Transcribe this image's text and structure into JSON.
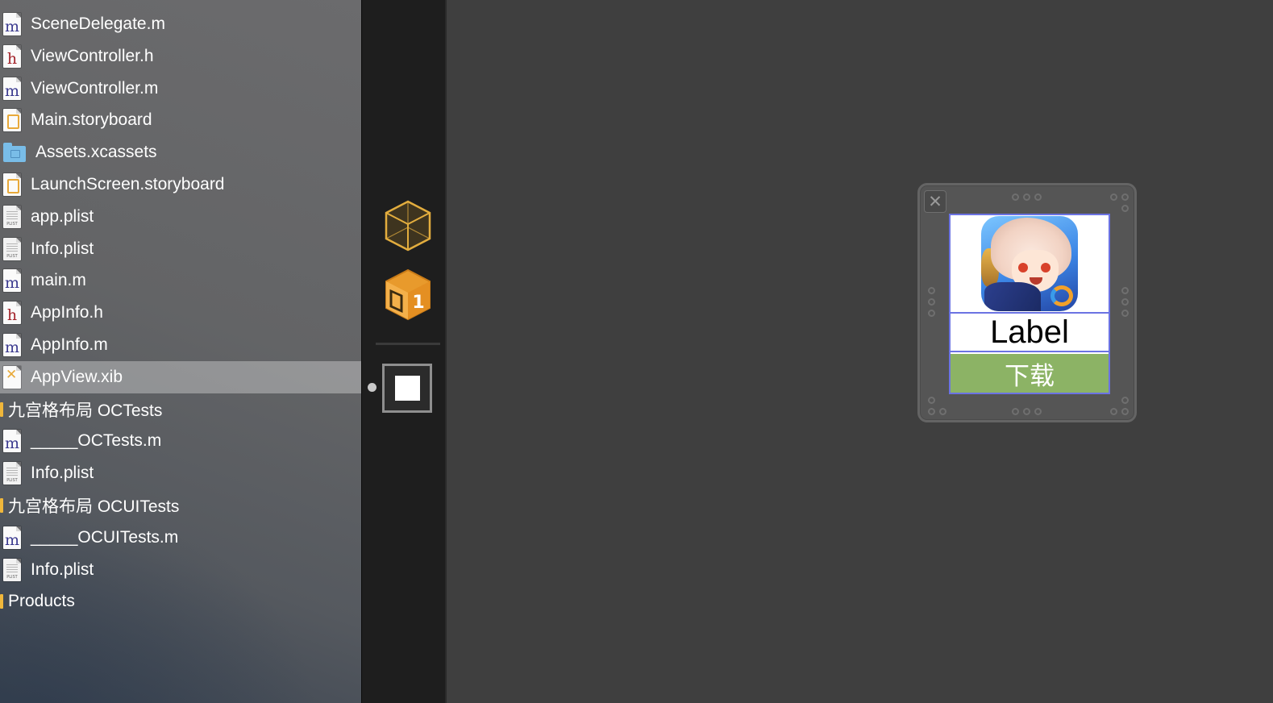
{
  "navigator": {
    "rows": [
      {
        "kind": "file",
        "type": "m",
        "name": "SceneDelegate.m",
        "selected": false
      },
      {
        "kind": "file",
        "type": "h",
        "name": "ViewController.h",
        "selected": false
      },
      {
        "kind": "file",
        "type": "m",
        "name": "ViewController.m",
        "selected": false
      },
      {
        "kind": "file",
        "type": "storyboard",
        "name": "Main.storyboard",
        "selected": false
      },
      {
        "kind": "folder",
        "type": "xcassets",
        "name": "Assets.xcassets",
        "selected": false
      },
      {
        "kind": "file",
        "type": "storyboard",
        "name": "LaunchScreen.storyboard",
        "selected": false
      },
      {
        "kind": "file",
        "type": "plist",
        "name": "app.plist",
        "selected": false
      },
      {
        "kind": "file",
        "type": "plist",
        "name": "Info.plist",
        "selected": false
      },
      {
        "kind": "file",
        "type": "m",
        "name": "main.m",
        "selected": false
      },
      {
        "kind": "file",
        "type": "h",
        "name": "AppInfo.h",
        "selected": false
      },
      {
        "kind": "file",
        "type": "m",
        "name": "AppInfo.m",
        "selected": false
      },
      {
        "kind": "file",
        "type": "xib",
        "name": "AppView.xib",
        "selected": true
      },
      {
        "kind": "group",
        "type": "group",
        "name": "九宫格布局 OCTests",
        "selected": false
      },
      {
        "kind": "file",
        "type": "m",
        "name": "_____OCTests.m",
        "selected": false
      },
      {
        "kind": "file",
        "type": "plist",
        "name": "Info.plist",
        "selected": false
      },
      {
        "kind": "group",
        "type": "group",
        "name": "九宫格布局 OCUITests",
        "selected": false
      },
      {
        "kind": "file",
        "type": "m",
        "name": "_____OCUITests.m",
        "selected": false
      },
      {
        "kind": "file",
        "type": "plist",
        "name": "Info.plist",
        "selected": false
      },
      {
        "kind": "group",
        "type": "group",
        "name": "Products",
        "selected": false
      }
    ],
    "icon_glyphs": {
      "m": "m",
      "h": "h",
      "plist": "PLIST"
    }
  },
  "dock": {
    "placeholder_icon": "placeholder-cube-icon",
    "file_owner_icon": "file-owner-cube-icon",
    "file_owner_badge": "1",
    "view_icon": "view-object-icon"
  },
  "canvas": {
    "close_glyph": "✕",
    "app_view": {
      "label_text": "Label",
      "button_title": "下载",
      "button_color": "#8cb365",
      "selection_color": "#6b73e3"
    }
  },
  "colors": {
    "navigator_bg": "#666668",
    "selection": "#9a9a9a",
    "canvas_bg": "#3f3f3f",
    "group_marker": "#f0b73b",
    "swift_m_glyph": "#3b3a8f",
    "h_glyph": "#a3232a"
  }
}
